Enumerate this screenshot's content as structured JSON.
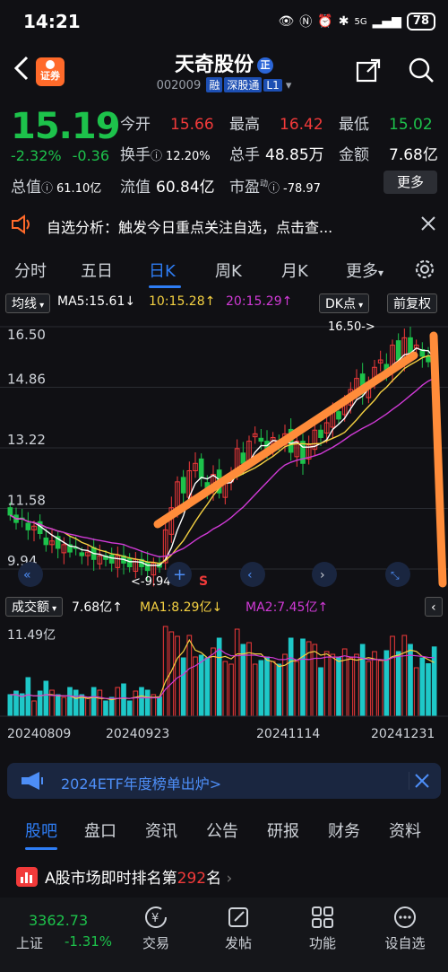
{
  "status": {
    "time": "14:21",
    "battery": "78",
    "network": "5G"
  },
  "header": {
    "stock_name": "天奇股份",
    "name_badge": "正",
    "logo_text": "证券",
    "code": "002009",
    "tags": [
      "融",
      "深股通",
      "L1"
    ]
  },
  "quote": {
    "price": "15.19",
    "change_pct": "-2.32%",
    "change_abs": "-0.36",
    "open_label": "今开",
    "open_value": "15.66",
    "high_label": "最高",
    "high_value": "16.42",
    "low_label": "最低",
    "low_value": "15.02",
    "turnover_label": "换手",
    "turnover_value": "12.20%",
    "volume_label": "总手",
    "volume_value": "48.85万",
    "amount_label": "金额",
    "amount_value": "7.68亿",
    "total_cap_label": "总值",
    "total_cap_value": "61.10亿",
    "float_cap_label": "流值",
    "float_cap_value": "60.84亿",
    "pe_label": "市盈",
    "pe_sup": "动",
    "pe_value": "-78.97",
    "more_label": "更多"
  },
  "alert": {
    "text": "自选分析：触发今日重点关注自选，点击查..."
  },
  "tabs": [
    {
      "label": "分时"
    },
    {
      "label": "五日"
    },
    {
      "label": "日K"
    },
    {
      "label": "周K"
    },
    {
      "label": "月K"
    },
    {
      "label": "更多"
    }
  ],
  "chart_head": {
    "ma_type": "均线",
    "ma5": "MA5:15.61↓",
    "ma10": "10:15.28↑",
    "ma20": "20:15.29↑",
    "dk_label": "DK点",
    "adjust_label": "前复权"
  },
  "colors": {
    "up": "#f23a3a",
    "down": "#1dc24b",
    "ma5": "#ffffff",
    "ma10": "#f5d142",
    "ma20": "#d03ad6",
    "annotation": "#ff8c3a",
    "accent": "#2e7df5"
  },
  "chart_data": {
    "type": "candlestick",
    "y_ticks": [
      "16.50",
      "14.86",
      "13.22",
      "11.58",
      "9.94"
    ],
    "ylim": [
      9.94,
      16.5
    ],
    "high_marker": "16.50->",
    "low_marker": "<-9.94",
    "mid_marker": "S",
    "x_ticks": [
      "20240809",
      "20240923",
      "20241114",
      "20241231"
    ],
    "closes": [
      11.4,
      11.2,
      11.3,
      11.0,
      11.1,
      10.9,
      10.6,
      10.7,
      10.5,
      10.6,
      10.4,
      10.5,
      10.3,
      10.4,
      10.2,
      10.3,
      10.2,
      10.1,
      10.3,
      10.1,
      10.0,
      10.2,
      10.0,
      9.9,
      10.1,
      9.99,
      11.0,
      11.6,
      12.3,
      12.0,
      12.6,
      12.8,
      12.4,
      12.1,
      12.5,
      12.0,
      12.3,
      12.5,
      13.2,
      12.8,
      13.4,
      13.6,
      13.4,
      13.2,
      13.5,
      13.3,
      13.6,
      13.1,
      13.4,
      12.8,
      13.3,
      13.7,
      13.5,
      13.9,
      14.2,
      14.0,
      14.5,
      14.8,
      15.1,
      14.7,
      15.0,
      15.4,
      15.6,
      15.3,
      16.0,
      15.6,
      16.2,
      15.8,
      16.0,
      15.7,
      15.55,
      15.19
    ]
  },
  "volume_head": {
    "label": "成交额",
    "value": "7.68亿↑",
    "ma1": "MA1:8.29亿↓",
    "ma2": "MA2:7.45亿↑",
    "max_tick": "11.49亿"
  },
  "promo": {
    "text": "2024ETF年度榜单出炉>"
  },
  "bottom_tabs": [
    {
      "label": "股吧"
    },
    {
      "label": "盘口"
    },
    {
      "label": "资讯"
    },
    {
      "label": "公告"
    },
    {
      "label": "研报"
    },
    {
      "label": "财务"
    },
    {
      "label": "资料"
    }
  ],
  "rank": {
    "prefix": "A股市场即时排名第",
    "number": "292",
    "suffix": "名"
  },
  "footer": {
    "index_value": "3362.73",
    "index_name": "上证",
    "index_change": "-1.31%",
    "buttons": [
      {
        "label": "交易",
        "icon": "yen-icon"
      },
      {
        "label": "发帖",
        "icon": "edit-icon"
      },
      {
        "label": "功能",
        "icon": "grid-icon"
      },
      {
        "label": "设自选",
        "icon": "dots-icon"
      }
    ]
  }
}
